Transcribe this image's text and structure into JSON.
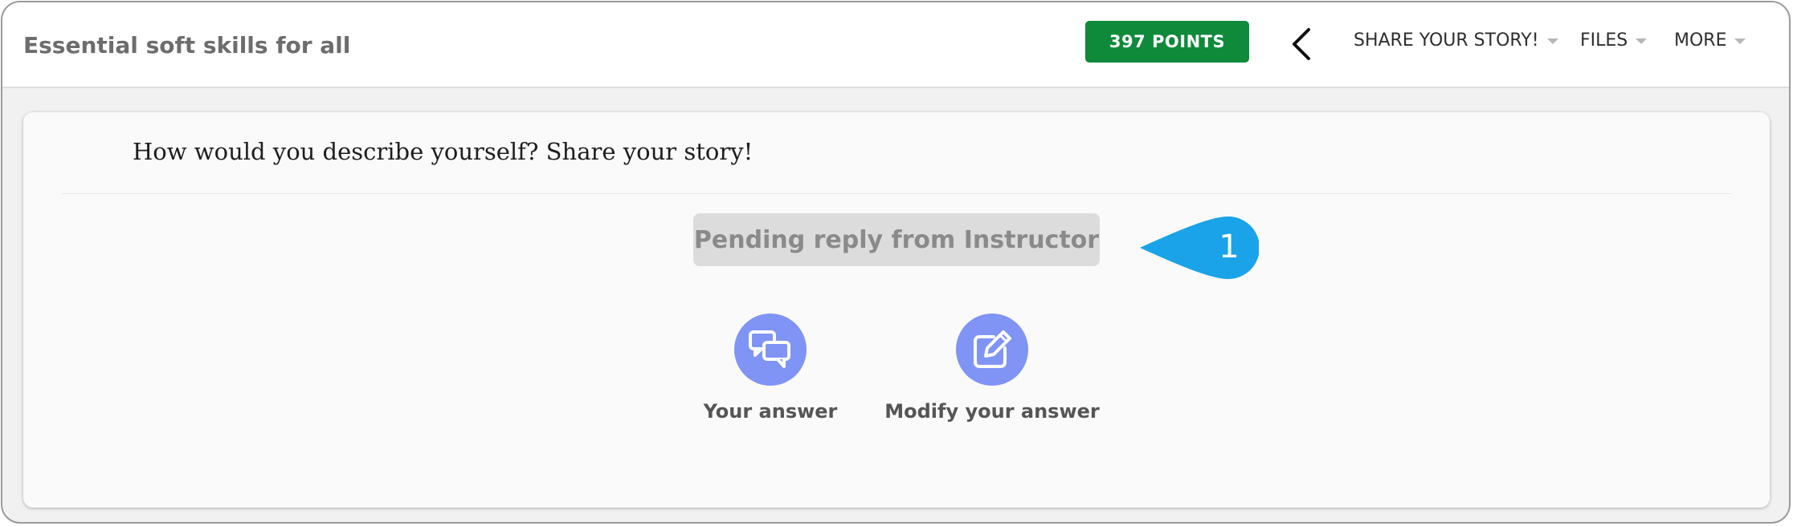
{
  "header": {
    "course_title": "Essential soft skills for all",
    "points_label": "397 POINTS",
    "nav": [
      {
        "label": "SHARE YOUR STORY!"
      },
      {
        "label": "FILES"
      },
      {
        "label": "MORE"
      }
    ]
  },
  "activity": {
    "question": "How would you describe yourself? Share your story!",
    "status": "Pending reply from Instructor",
    "callout_number": "1",
    "actions": [
      {
        "label": "Your answer",
        "icon": "chat-bubbles-icon"
      },
      {
        "label": "Modify your answer",
        "icon": "edit-square-icon"
      }
    ]
  },
  "colors": {
    "points_badge": "#0e8a3a",
    "action_circle": "#7f94f5",
    "callout": "#1aa3e8",
    "status_pill": "#dcdcdc"
  }
}
